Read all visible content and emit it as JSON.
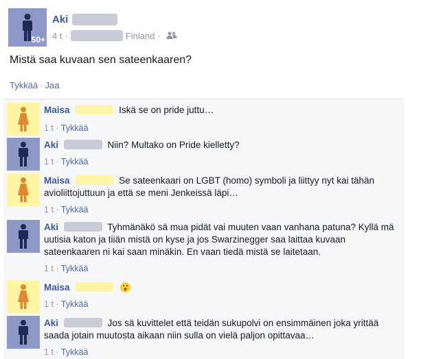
{
  "post": {
    "author": "Aki",
    "badge": "50+",
    "time": "4 t",
    "location": "Finland",
    "text": "Mistä saa kuvaan sen sateenkaaren?",
    "actions": {
      "like": "Tykkää",
      "share": "Jaa"
    }
  },
  "comments": [
    {
      "name": "Maisa",
      "text": "Iskä se on pride juttu…",
      "time": "1 t",
      "like": "Tykkää"
    },
    {
      "name": "Aki",
      "text": "Niin? Multako on Pride kielletty?",
      "time": "1 t",
      "like": "Tykkää"
    },
    {
      "name": "Maisa",
      "text": "Se sateenkaari on LGBT (homo) symboli ja liittyy nyt kai tähän avioliittojuttuun ja että se meni Jenkeissä läpi…",
      "time": "1 t",
      "like": "Tykkää"
    },
    {
      "name": "Aki",
      "text": "Tyhmänäkö sä mua pidät vai muuten vaan vanhana patuna? Kyllä mä uutisia katon ja tiiän mistä on kyse ja jos Swarzinegger saa laittaa kuvaan sateenkaaren ni kai saan minäkin. En vaan tiedä mistä se laitetaan.",
      "time": "1 t",
      "like": "Tykkää"
    },
    {
      "name": "Maisa",
      "text": "",
      "time": "1 t",
      "like": "Tykkää"
    },
    {
      "name": "Aki",
      "text": "Jos sä kuvittelet että teidän sukupolvi on ensimmäinen joka yrittää saada jotain muutosta aikaan niin sulla on vielä paljon opittavaa…",
      "time": "1 t",
      "like": "Tykkää"
    }
  ],
  "colors": {
    "link": "#3b5998",
    "male_avatar": "#8c99c6",
    "female_avatar": "#fff5a3",
    "redaction": "#c9ccd6"
  },
  "icons": {
    "male_figure": "person-male-icon",
    "female_figure": "person-female-icon",
    "audience": "friends-icon",
    "emoji": "surprised-face-icon"
  }
}
